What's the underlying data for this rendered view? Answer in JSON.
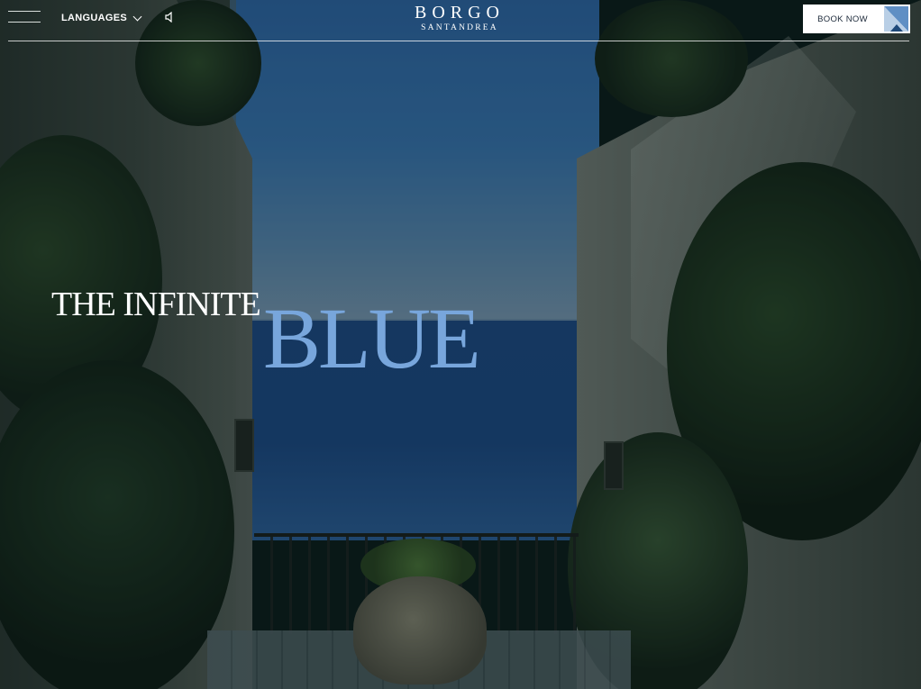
{
  "header": {
    "languages_label": "LANGUAGES",
    "logo_top": "BORGO",
    "logo_bottom": "SANTANDREA",
    "book_now_label": "BOOK NOW"
  },
  "hero": {
    "headline_line1": "THE INFINITE",
    "headline_line2": "BLUE"
  },
  "colors": {
    "accent_blue": "#78a6dc",
    "text_white": "#ffffff",
    "button_bg": "#ffffff"
  },
  "icons": {
    "menu": "hamburger-icon",
    "languages": "chevron-down-icon",
    "sound": "speaker-icon",
    "book": "brand-mark-icon"
  }
}
